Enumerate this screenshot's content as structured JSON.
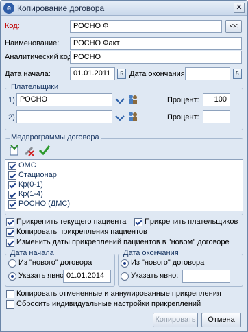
{
  "window": {
    "title": "Копирование договора",
    "close": "✕"
  },
  "fields": {
    "code_label": "Код:",
    "code_value": "РОСНО Ф",
    "code_btn": "<<",
    "name_label": "Наименование:",
    "name_value": "РОСНО Факт",
    "analytic_label": "Аналитический код:",
    "analytic_value": "РОСНО",
    "start_label": "Дата начала:",
    "start_value": "01.01.2011",
    "end_label": "Дата окончания:",
    "end_value": ""
  },
  "payers": {
    "title": "Плательщики",
    "rows": [
      {
        "num": "1)",
        "value": "РОСНО",
        "percent_label": "Процент:",
        "percent": "100"
      },
      {
        "num": "2)",
        "value": "",
        "percent_label": "Процент:",
        "percent": ""
      }
    ]
  },
  "programs": {
    "title": "Медпрограммы договора",
    "items": [
      {
        "label": "ОМС",
        "checked": true
      },
      {
        "label": "Стационар",
        "checked": true
      },
      {
        "label": "Кр(0-1)",
        "checked": true
      },
      {
        "label": "Кр(1-4)",
        "checked": true
      },
      {
        "label": "РОСНО (ДМС)",
        "checked": true
      }
    ]
  },
  "options": {
    "attach_patient": "Прикрепить текущего пациента",
    "attach_payers": "Прикрепить плательщиков",
    "copy_attachments": "Копировать прикрепления пациентов",
    "change_dates": "Изменить даты прикреплений пациентов в \"новом\" договоре"
  },
  "start_group": {
    "title": "Дата начала",
    "from_new": "Из \"нового\" договора",
    "explicit": "Указать явно:",
    "explicit_value": "01.01.2014"
  },
  "end_group": {
    "title": "Дата окончания",
    "from_new": "Из \"нового\" договора",
    "explicit": "Указать явно:",
    "explicit_value": ""
  },
  "bottom_options": {
    "copy_cancelled": "Копировать отмененные и аннулированные прикрепления",
    "reset_settings": "Сбросить индивидуальные настройки прикреплений"
  },
  "buttons": {
    "copy": "Копировать",
    "cancel": "Отмена"
  },
  "colors": {
    "required_label": "#c00000",
    "accent": "#1e3f8a"
  }
}
